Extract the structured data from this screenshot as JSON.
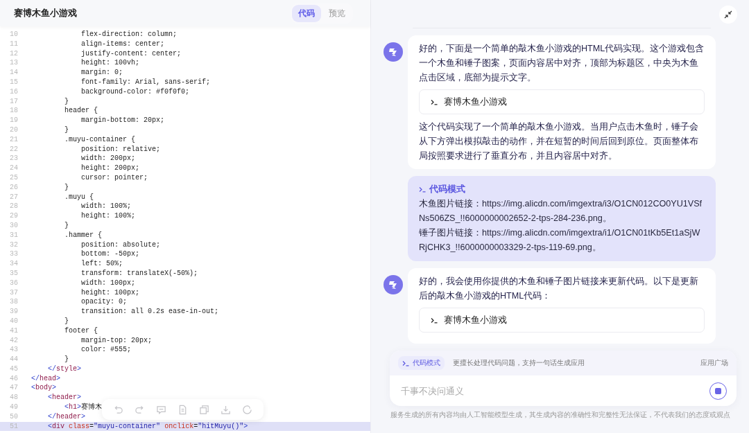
{
  "editor": {
    "title": "赛博木鱼小游戏",
    "tabs": [
      {
        "label": "代码",
        "selected": true
      },
      {
        "label": "预览",
        "selected": false
      }
    ],
    "code_lines": [
      {
        "number": "10",
        "text": "            flex-direction: column;",
        "kind": "css",
        "highlighted": false
      },
      {
        "number": "11",
        "text": "            align-items: center;",
        "kind": "css",
        "highlighted": false
      },
      {
        "number": "12",
        "text": "            justify-content: center;",
        "kind": "css",
        "highlighted": false
      },
      {
        "number": "13",
        "text": "            height: 100vh;",
        "kind": "css",
        "highlighted": false
      },
      {
        "number": "14",
        "text": "            margin: 0;",
        "kind": "css",
        "highlighted": false
      },
      {
        "number": "15",
        "text": "            font-family: Arial, sans-serif;",
        "kind": "css",
        "highlighted": false
      },
      {
        "number": "16",
        "text": "            background-color: #f0f0f0;",
        "kind": "css",
        "highlighted": false
      },
      {
        "number": "17",
        "text": "        }",
        "kind": "css",
        "highlighted": false
      },
      {
        "number": "18",
        "text": "        header {",
        "kind": "css",
        "highlighted": false
      },
      {
        "number": "19",
        "text": "            margin-bottom: 20px;",
        "kind": "css",
        "highlighted": false
      },
      {
        "number": "20",
        "text": "        }",
        "kind": "css",
        "highlighted": false
      },
      {
        "number": "21",
        "text": "        .muyu-container {",
        "kind": "css",
        "highlighted": false
      },
      {
        "number": "22",
        "text": "            position: relative;",
        "kind": "css",
        "highlighted": false
      },
      {
        "number": "23",
        "text": "            width: 200px;",
        "kind": "css",
        "highlighted": false
      },
      {
        "number": "24",
        "text": "            height: 200px;",
        "kind": "css",
        "highlighted": false
      },
      {
        "number": "25",
        "text": "            cursor: pointer;",
        "kind": "css",
        "highlighted": false
      },
      {
        "number": "26",
        "text": "        }",
        "kind": "css",
        "highlighted": false
      },
      {
        "number": "27",
        "text": "        .muyu {",
        "kind": "css",
        "highlighted": false
      },
      {
        "number": "28",
        "text": "            width: 100%;",
        "kind": "css",
        "highlighted": false
      },
      {
        "number": "29",
        "text": "            height: 100%;",
        "kind": "css",
        "highlighted": false
      },
      {
        "number": "30",
        "text": "        }",
        "kind": "css",
        "highlighted": false
      },
      {
        "number": "31",
        "text": "        .hammer {",
        "kind": "css",
        "highlighted": false
      },
      {
        "number": "32",
        "text": "            position: absolute;",
        "kind": "css",
        "highlighted": false
      },
      {
        "number": "33",
        "text": "            bottom: -50px;",
        "kind": "css",
        "highlighted": false
      },
      {
        "number": "34",
        "text": "            left: 50%;",
        "kind": "css",
        "highlighted": false
      },
      {
        "number": "35",
        "text": "            transform: translateX(-50%);",
        "kind": "css",
        "highlighted": false
      },
      {
        "number": "36",
        "text": "            width: 100px;",
        "kind": "css",
        "highlighted": false
      },
      {
        "number": "37",
        "text": "            height: 100px;",
        "kind": "css",
        "highlighted": false
      },
      {
        "number": "38",
        "text": "            opacity: 0;",
        "kind": "css",
        "highlighted": false
      },
      {
        "number": "39",
        "text": "            transition: all 0.2s ease-in-out;",
        "kind": "css",
        "highlighted": false
      },
      {
        "number": "40",
        "text": "        }",
        "kind": "css",
        "highlighted": false
      },
      {
        "number": "41",
        "text": "        footer {",
        "kind": "css",
        "highlighted": false
      },
      {
        "number": "42",
        "text": "            margin-top: 20px;",
        "kind": "css",
        "highlighted": false
      },
      {
        "number": "43",
        "text": "            color: #555;",
        "kind": "css",
        "highlighted": false
      },
      {
        "number": "44",
        "text": "        }",
        "kind": "css",
        "highlighted": false
      },
      {
        "number": "45",
        "text": "    </style>",
        "kind": "markup",
        "highlighted": false
      },
      {
        "number": "46",
        "text": "</head>",
        "kind": "markup",
        "highlighted": false
      },
      {
        "number": "47",
        "text": "<body>",
        "kind": "markup",
        "highlighted": false
      },
      {
        "number": "48",
        "text": "    <header>",
        "kind": "markup",
        "highlighted": false
      },
      {
        "number": "49",
        "text": "        <h1>赛博木",
        "kind": "markup",
        "highlighted": false
      },
      {
        "number": "50",
        "text": "    </header>",
        "kind": "markup",
        "highlighted": false
      },
      {
        "number": "51",
        "text": "    <div class=\"muyu-container\" onclick=\"hitMuyu()\">",
        "kind": "markup",
        "highlighted": true
      }
    ]
  },
  "chat": {
    "messages": [
      {
        "kind": "assistant",
        "blocks": [
          {
            "kind": "text",
            "text": "好的，下面是一个简单的敲木鱼小游戏的HTML代码实现。这个游戏包含一个木鱼和锤子图案，页面内容居中对齐，顶部为标题区，中央为木鱼点击区域，底部为提示文字。"
          },
          {
            "kind": "card",
            "title": "赛博木鱼小游戏"
          },
          {
            "kind": "text",
            "text": "这个代码实现了一个简单的敲木鱼小游戏。当用户点击木鱼时，锤子会从下方弹出模拟敲击的动作，并在短暂的时间后回到原位。页面整体布局按照要求进行了垂直分布，并且内容居中对齐。"
          }
        ]
      },
      {
        "kind": "user",
        "mode_label": "代码模式",
        "lines": [
          "木鱼图片链接：https://img.alicdn.com/imgextra/i3/O1CN012CO0YU1VSfNs506ZS_!!6000000002652-2-tps-284-236.png。",
          "锤子图片链接：https://img.alicdn.com/imgextra/i1/O1CN01tKb5Et1aSjWRjCHK3_!!6000000003329-2-tps-119-69.png。"
        ]
      },
      {
        "kind": "assistant",
        "blocks": [
          {
            "kind": "text",
            "text": "好的，我会使用你提供的木鱼和锤子图片链接来更新代码。以下是更新后的敲木鱼小游戏的HTML代码："
          },
          {
            "kind": "card",
            "title": "赛博木鱼小游戏"
          }
        ]
      }
    ]
  },
  "composer": {
    "mode_chip": "代码模式",
    "hint": "更擅长处理代码问题，支持一句话生成应用",
    "link": "应用广场",
    "placeholder": "千事不决问通义"
  },
  "disclaimer": "服务生成的所有内容均由人工智能模型生成，其生成内容的准确性和完整性无法保证，不代表我们的态度或观点"
}
